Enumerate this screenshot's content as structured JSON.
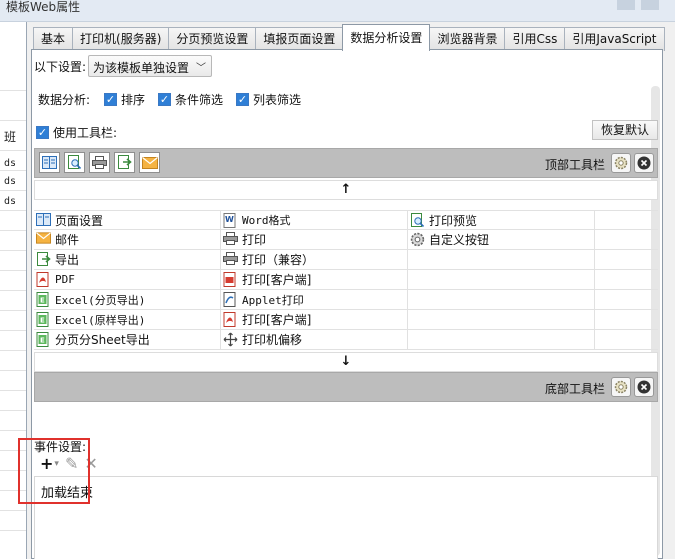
{
  "window": {
    "title": "模板Web属性"
  },
  "background_sheet": {
    "cells": [
      "班",
      "ds",
      "ds",
      "ds"
    ]
  },
  "tabs": [
    {
      "label": "基本",
      "active": false
    },
    {
      "label": "打印机(服务器)",
      "active": false
    },
    {
      "label": "分页预览设置",
      "active": false
    },
    {
      "label": "填报页面设置",
      "active": false
    },
    {
      "label": "数据分析设置",
      "active": true
    },
    {
      "label": "浏览器背景",
      "active": false
    },
    {
      "label": "引用Css",
      "active": false
    },
    {
      "label": "引用JavaScript",
      "active": false
    }
  ],
  "settings": {
    "scope_label": "以下设置:",
    "scope_value": "为该模板单独设置",
    "analysis_label": "数据分析:",
    "sort_label": "排序",
    "condition_filter_label": "条件筛选",
    "column_filter_label": "列表筛选",
    "use_toolbar_label": "使用工具栏:",
    "restore_default_label": "恢复默认"
  },
  "top_toolbar": {
    "label": "顶部工具栏"
  },
  "bottom_toolbar": {
    "label": "底部工具栏"
  },
  "arrows": {
    "up": "↑",
    "down": "↓"
  },
  "buttons_grid": [
    [
      "页面设置",
      "Word格式",
      "打印预览",
      ""
    ],
    [
      "邮件",
      "打印",
      "自定义按钮",
      ""
    ],
    [
      "导出",
      "打印（兼容）",
      "",
      ""
    ],
    [
      "PDF",
      "打印[客户端]",
      "",
      ""
    ],
    [
      "Excel(分页导出)",
      "Applet打印",
      "",
      ""
    ],
    [
      "Excel(原样导出)",
      "打印[客户端]",
      "",
      ""
    ],
    [
      "分页分Sheet导出",
      "打印机偏移",
      "",
      ""
    ]
  ],
  "events": {
    "label": "事件设置:",
    "items": [
      "加载结束"
    ]
  },
  "colors": {
    "highlight": "#e0312c",
    "checkbox": "#2f7fd6",
    "toolbar": "#bdbdbd"
  }
}
